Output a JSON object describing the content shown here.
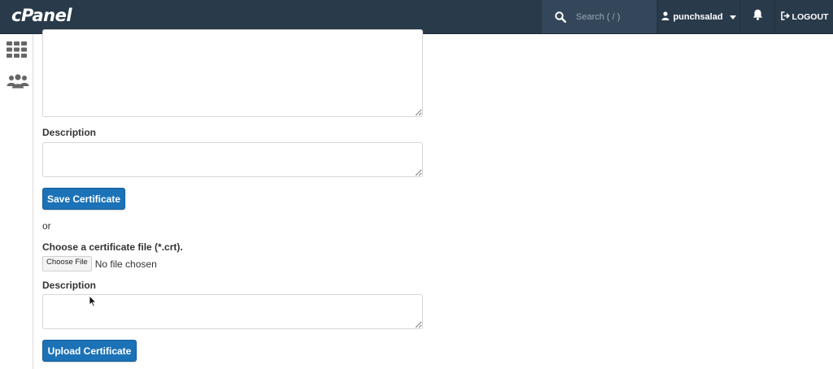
{
  "header": {
    "logo": "cPanel",
    "search_placeholder": "Search ( / )",
    "username": "punchsalad",
    "logout_label": "LOGOUT"
  },
  "sidebar": {
    "items": [
      {
        "icon": "grid-icon"
      },
      {
        "icon": "users-icon"
      }
    ]
  },
  "form": {
    "description_label_1": "Description",
    "save_button": "Save Certificate",
    "or_text": "or",
    "choose_file_label": "Choose a certificate file (*.crt).",
    "choose_file_button": "Choose File",
    "no_file_text": "No file chosen",
    "description_label_2": "Description",
    "upload_button": "Upload Certificate"
  },
  "colors": {
    "topbar": "#293a4a",
    "search_bg": "#34475a",
    "primary_button": "#1b72b7"
  }
}
